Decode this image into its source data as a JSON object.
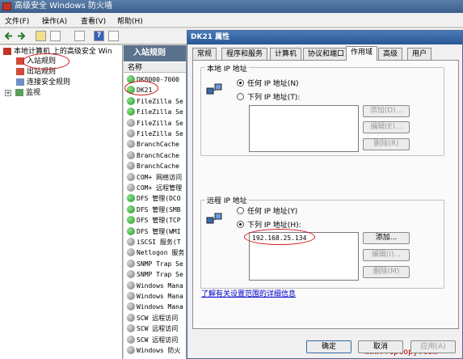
{
  "window": {
    "title": "高级安全 Windows 防火墙"
  },
  "menu": [
    {
      "label": "文件(F)"
    },
    {
      "label": "操作(A)"
    },
    {
      "label": "查看(V)"
    },
    {
      "label": "帮助(H)"
    }
  ],
  "tree": {
    "root": "本地计算机 上的高级安全 Win",
    "items": [
      {
        "label": "入站规则"
      },
      {
        "label": "出站规则"
      },
      {
        "label": "连接安全规则"
      },
      {
        "label": "监视"
      }
    ]
  },
  "list": {
    "header": "入站规则",
    "column": "名称",
    "rows": [
      {
        "name": "DK8000-7000",
        "status": "green"
      },
      {
        "name": "DK21",
        "status": "green"
      },
      {
        "name": "FileZilla Se",
        "status": "green"
      },
      {
        "name": "FileZilla Se",
        "status": "green"
      },
      {
        "name": "FileZilla Se",
        "status": "gray"
      },
      {
        "name": "FileZilla Se",
        "status": "gray"
      },
      {
        "name": "BranchCache",
        "status": "gray"
      },
      {
        "name": "BranchCache",
        "status": "gray"
      },
      {
        "name": "BranchCache",
        "status": "gray"
      },
      {
        "name": "COM+ 网络访问",
        "status": "gray"
      },
      {
        "name": "COM+ 远程管理",
        "status": "gray"
      },
      {
        "name": "DFS 管理(DCO",
        "status": "green"
      },
      {
        "name": "DFS 管理(SMB",
        "status": "green"
      },
      {
        "name": "DFS 管理(TCP",
        "status": "green"
      },
      {
        "name": "DFS 管理(WMI",
        "status": "green"
      },
      {
        "name": "iSCSI 服务(T",
        "status": "gray"
      },
      {
        "name": "Netlogon 服务",
        "status": "gray"
      },
      {
        "name": "SNMP Trap Se",
        "status": "gray"
      },
      {
        "name": "SNMP Trap Se",
        "status": "gray"
      },
      {
        "name": "Windows Mana",
        "status": "gray"
      },
      {
        "name": "Windows Mana",
        "status": "gray"
      },
      {
        "name": "Windows Mana",
        "status": "gray"
      },
      {
        "name": "SCW 远程访问",
        "status": "gray"
      },
      {
        "name": "SCW 远程访问",
        "status": "gray"
      },
      {
        "name": "SCW 远程访问",
        "status": "gray"
      },
      {
        "name": "Windows 防火",
        "status": "gray"
      }
    ]
  },
  "dialog": {
    "title": "DK21 属性",
    "tabs": [
      {
        "label": "常规"
      },
      {
        "label": "程序和服务"
      },
      {
        "label": "计算机"
      },
      {
        "label": "协议和端口"
      },
      {
        "label": "作用域"
      },
      {
        "label": "高级"
      },
      {
        "label": "用户"
      }
    ],
    "active_tab": "作用域",
    "local": {
      "group_label": "本地 IP 地址",
      "radio_any": "任何 IP 地址(N)",
      "radio_list": "下列 IP 地址(T):",
      "add": "添加(D)...",
      "edit": "编辑(E)...",
      "remove": "删除(R)"
    },
    "remote": {
      "group_label": "远程 IP 地址",
      "radio_any": "任何 IP 地址(Y)",
      "radio_list": "下列 IP 地址(H):",
      "entries": [
        "192.168.25.134"
      ],
      "add": "添加...",
      "edit": "编辑(I)...",
      "remove": "删除(M)"
    },
    "link": "了解有关设置范围的详细信息",
    "watermark": "www.ftpcopy.com",
    "buttons": {
      "ok": "确定",
      "cancel": "取消",
      "apply": "应用(A)"
    }
  }
}
